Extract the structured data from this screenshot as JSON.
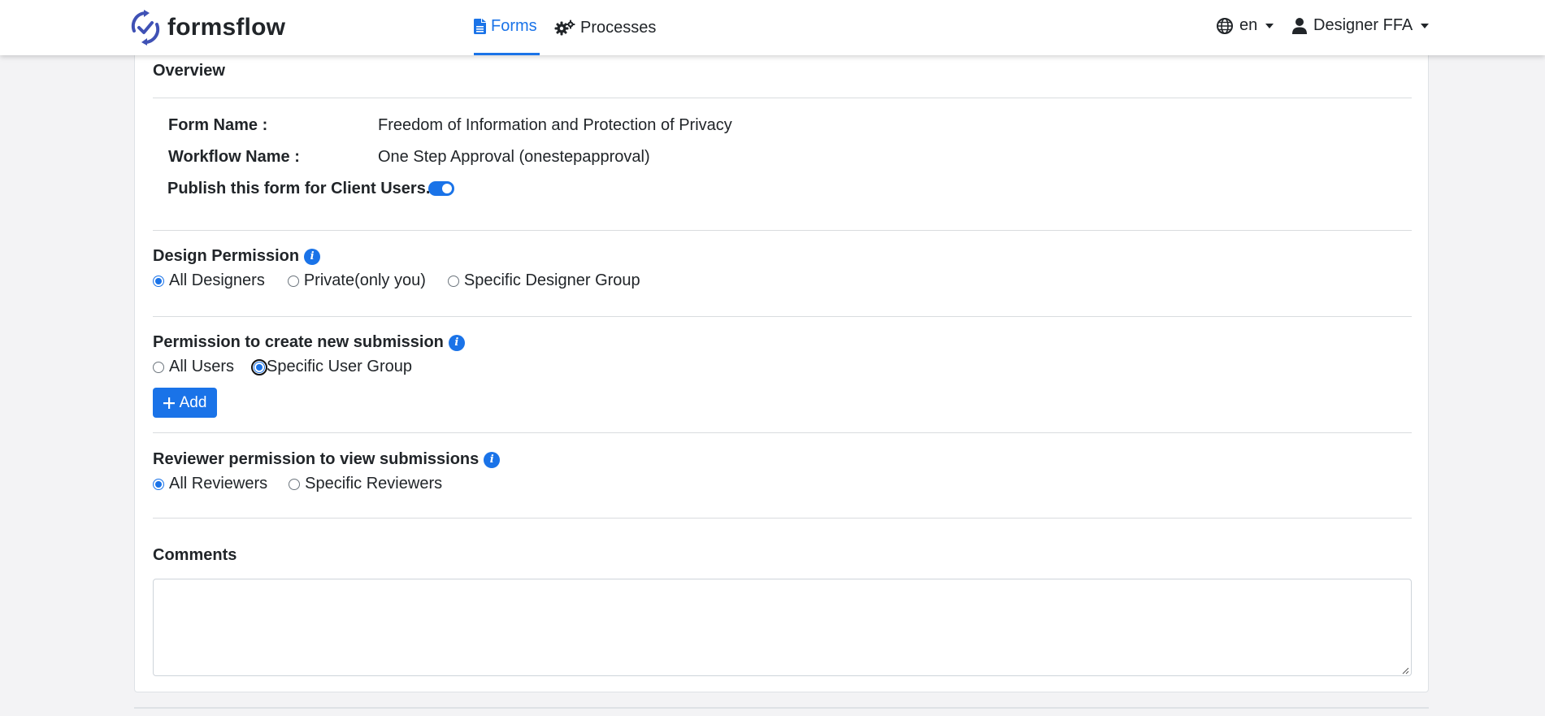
{
  "header": {
    "brand": "formsflow",
    "nav": [
      {
        "label": "Forms",
        "icon": "file-icon",
        "active": true
      },
      {
        "label": "Processes",
        "icon": "gears-icon",
        "active": false
      }
    ],
    "language": "en",
    "user": "Designer FFA"
  },
  "overview": {
    "title": "Overview",
    "form_name_label": "Form Name :",
    "form_name_value": "Freedom of Information and Protection of Privacy",
    "workflow_name_label": "Workflow Name :",
    "workflow_name_value": "One Step Approval (onestepapproval)",
    "publish_label": "Publish this form for Client Users.",
    "publish_enabled": true
  },
  "design_permission": {
    "title": "Design Permission",
    "options": [
      "All Designers",
      "Private(only you)",
      "Specific Designer Group"
    ],
    "selected": "All Designers"
  },
  "submission_permission": {
    "title": "Permission to create new submission",
    "options": [
      "All Users",
      "Specific User Group"
    ],
    "selected": "Specific User Group",
    "add_label": "Add"
  },
  "reviewer_permission": {
    "title": "Reviewer permission to view submissions",
    "options": [
      "All Reviewers",
      "Specific Reviewers"
    ],
    "selected": "All Reviewers"
  },
  "comments": {
    "title": "Comments",
    "value": ""
  },
  "colors": {
    "accent": "#1a73e8",
    "background": "#f3f3f5"
  }
}
